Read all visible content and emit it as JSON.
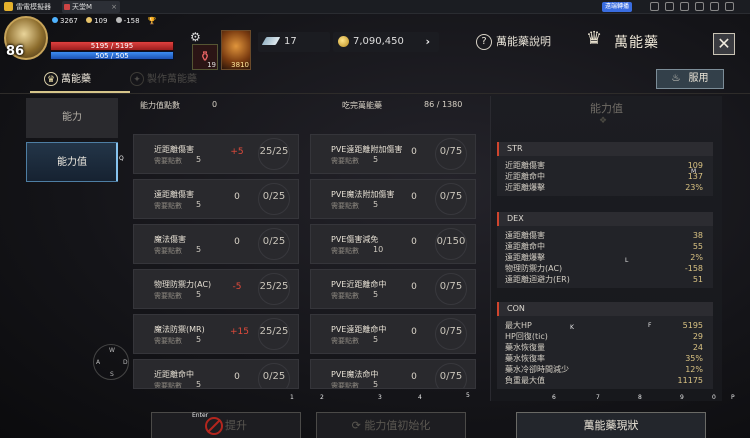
{
  "emulator": {
    "app_name": "雷電模擬器",
    "tab_title": "天堂M",
    "tab_close": "×",
    "stream_label": "遠端轉播"
  },
  "hud": {
    "level": "86",
    "stat1": "3267",
    "stat2": "109",
    "stat3": "-158",
    "hp": "5195 / 5195",
    "mp": "505 / 505",
    "hp_fraction": 1.0,
    "mp_fraction": 1.0,
    "potion_count": "19",
    "skill_count": "3810",
    "feather": "17",
    "gold": "7,090,450",
    "gold_arrow": "›",
    "help_label": "萬能藥說明",
    "window_title": "萬能藥",
    "close": "✕"
  },
  "tabs": {
    "active": "萬能藥",
    "inactive": "製作萬能藥"
  },
  "use_button": "服用",
  "sidebar": {
    "items": [
      {
        "label": "能力"
      },
      {
        "label": "能力值"
      }
    ]
  },
  "header": {
    "points_label": "能力值點數",
    "points_value": "0",
    "eaten_label": "吃完萬能藥",
    "eaten_value": "86 / 1380"
  },
  "need_label": "需要點數",
  "cards": [
    {
      "name": "近距離傷害",
      "bonus": "+5",
      "progress": "25/25",
      "need": "5"
    },
    {
      "name": "PVE遠距離附加傷害",
      "bonus": "0",
      "progress": "0/75",
      "need": "5"
    },
    {
      "name": "遠距離傷害",
      "bonus": "0",
      "progress": "0/25",
      "need": "5"
    },
    {
      "name": "PVE魔法附加傷害",
      "bonus": "0",
      "progress": "0/75",
      "need": "5"
    },
    {
      "name": "魔法傷害",
      "bonus": "0",
      "progress": "0/25",
      "need": "5"
    },
    {
      "name": "PVE傷害減免",
      "bonus": "0",
      "progress": "0/150",
      "need": "10"
    },
    {
      "name": "物理防禦力(AC)",
      "bonus": "-5",
      "progress": "25/25",
      "need": "5"
    },
    {
      "name": "PVE近距離命中",
      "bonus": "0",
      "progress": "0/75",
      "need": "5"
    },
    {
      "name": "魔法防禦(MR)",
      "bonus": "+15",
      "progress": "25/25",
      "need": "5"
    },
    {
      "name": "PVE遠距離命中",
      "bonus": "0",
      "progress": "0/75",
      "need": "5"
    },
    {
      "name": "近距離命中",
      "bonus": "0",
      "progress": "0/25",
      "need": "5"
    },
    {
      "name": "PVE魔法命中",
      "bonus": "0",
      "progress": "0/75",
      "need": "5"
    }
  ],
  "stats_panel": {
    "title": "能力值",
    "groups": [
      {
        "name": "STR",
        "rows": [
          {
            "label": "近距離傷害",
            "value": "109"
          },
          {
            "label": "近距離命中",
            "value": "137"
          },
          {
            "label": "近距離爆擊",
            "value": "23%"
          }
        ]
      },
      {
        "name": "DEX",
        "rows": [
          {
            "label": "遠距離傷害",
            "value": "38"
          },
          {
            "label": "遠距離命中",
            "value": "55"
          },
          {
            "label": "遠距離爆擊",
            "value": "2%"
          },
          {
            "label": "物理防禦力(AC)",
            "value": "-158"
          },
          {
            "label": "遠距離迴避力(ER)",
            "value": "51"
          }
        ]
      },
      {
        "name": "CON",
        "rows": [
          {
            "label": "最大HP",
            "value": "5195"
          },
          {
            "label": "HP回復(tic)",
            "value": "29"
          },
          {
            "label": "藥水恢復量",
            "value": "24"
          },
          {
            "label": "藥水恢復率",
            "value": "35%"
          },
          {
            "label": "藥水冷卻時間減少",
            "value": "12%"
          },
          {
            "label": "負重最大值",
            "value": "11175"
          }
        ]
      }
    ]
  },
  "bottom": {
    "raise": "提升",
    "reset": "能力值初始化",
    "current": "萬能藥現狀"
  },
  "key_hints": {
    "q": "Q",
    "m": "M",
    "l": "L",
    "k": "K",
    "f": "F",
    "enter": "Enter",
    "n1": "1",
    "n2": "2",
    "n3": "3",
    "n4": "4",
    "n5": "5",
    "n6": "6",
    "n7": "7",
    "n8": "8",
    "n9": "9",
    "n0": "0",
    "p": "P",
    "w": "W",
    "a": "A",
    "s": "S",
    "d": "D"
  }
}
